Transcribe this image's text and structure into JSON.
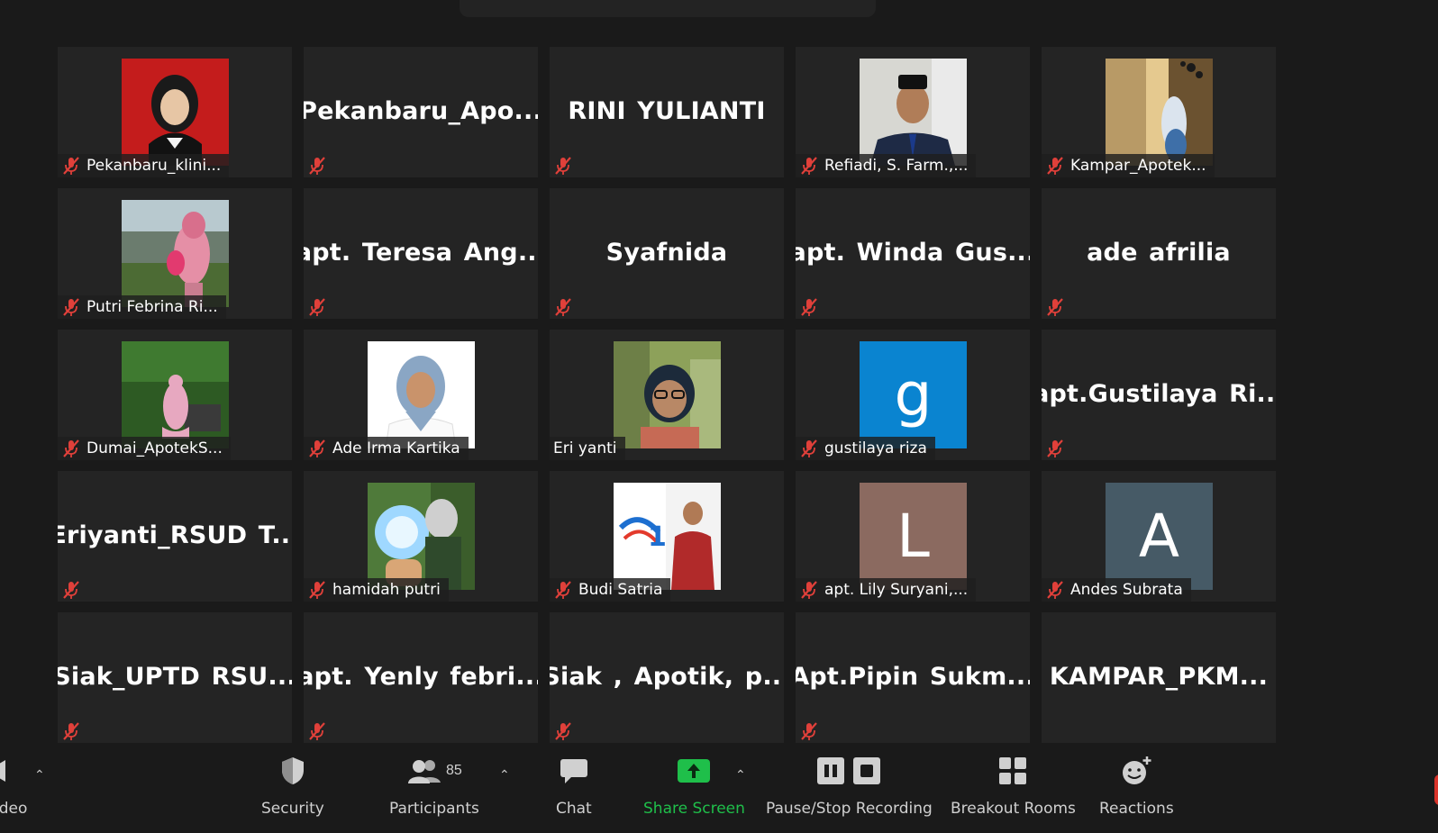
{
  "tiles": [
    {
      "type": "photo",
      "image_id": "photo-woman-red-bg",
      "label": "Pekanbaru_klini...",
      "muted": true
    },
    {
      "type": "name",
      "display": "Pekanbaru_Apo...",
      "muted": true
    },
    {
      "type": "name",
      "display": "RINI YULIANTI",
      "muted": true
    },
    {
      "type": "photo",
      "image_id": "photo-man-peci",
      "label": "Refiadi, S. Farm.,...",
      "muted": true
    },
    {
      "type": "photo",
      "image_id": "photo-woman-window",
      "label": "Kampar_Apotek...",
      "muted": true
    },
    {
      "type": "photo",
      "image_id": "photo-woman-child-outdoor",
      "label": "Putri Febrina Ri...",
      "muted": true
    },
    {
      "type": "name",
      "display": "apt. Teresa Ang...",
      "muted": true
    },
    {
      "type": "name",
      "display": "Syafnida",
      "muted": true
    },
    {
      "type": "name",
      "display": "apt. Winda Gus...",
      "muted": true
    },
    {
      "type": "name",
      "display": "ade afrilia",
      "muted": true
    },
    {
      "type": "photo",
      "image_id": "photo-woman-garden",
      "label": "Dumai_ApotekS...",
      "muted": true
    },
    {
      "type": "photo",
      "image_id": "photo-woman-hijab-white",
      "label": "Ade Irma Kartika",
      "muted": true
    },
    {
      "type": "photo",
      "image_id": "photo-woman-glasses-tree",
      "label": "Eri yanti",
      "muted": false
    },
    {
      "type": "letter",
      "letter": "g",
      "color": "#0a84d0",
      "label": "gustilaya riza",
      "muted": true
    },
    {
      "type": "name",
      "display": "apt.Gustilaya Ri...",
      "muted": true
    },
    {
      "type": "name",
      "display": "Eriyanti_RSUD T...",
      "muted": true
    },
    {
      "type": "photo",
      "image_id": "photo-anime-rasengan",
      "label": "hamidah putri",
      "muted": true
    },
    {
      "type": "photo",
      "image_id": "photo-man-batik-poster",
      "label": "Budi Satria",
      "muted": true
    },
    {
      "type": "letter",
      "letter": "L",
      "color": "#8b6a60",
      "label": "apt. Lily Suryani,...",
      "muted": true
    },
    {
      "type": "letter",
      "letter": "A",
      "color": "#465a66",
      "label": "Andes Subrata",
      "muted": true
    },
    {
      "type": "name",
      "display": "Siak_UPTD RSU...",
      "muted": true
    },
    {
      "type": "name",
      "display": "apt. Yenly febri...",
      "muted": true
    },
    {
      "type": "name",
      "display": "Siak , Apotik, p...",
      "muted": true
    },
    {
      "type": "name",
      "display": "Apt.Pipin Sukm...",
      "muted": true
    },
    {
      "type": "name",
      "display": "KAMPAR_PKM...",
      "muted": false
    }
  ],
  "toolbar": {
    "video_label": "ideo",
    "security_label": "Security",
    "participants_label": "Participants",
    "participants_count": "85",
    "chat_label": "Chat",
    "share_label": "Share Screen",
    "recording_label": "Pause/Stop Recording",
    "breakout_label": "Breakout Rooms",
    "reactions_label": "Reactions"
  },
  "colors": {
    "share_green": "#1fbf4a",
    "muted_red": "#e0403a",
    "bg": "#1a1a1a",
    "tile": "#242424"
  }
}
